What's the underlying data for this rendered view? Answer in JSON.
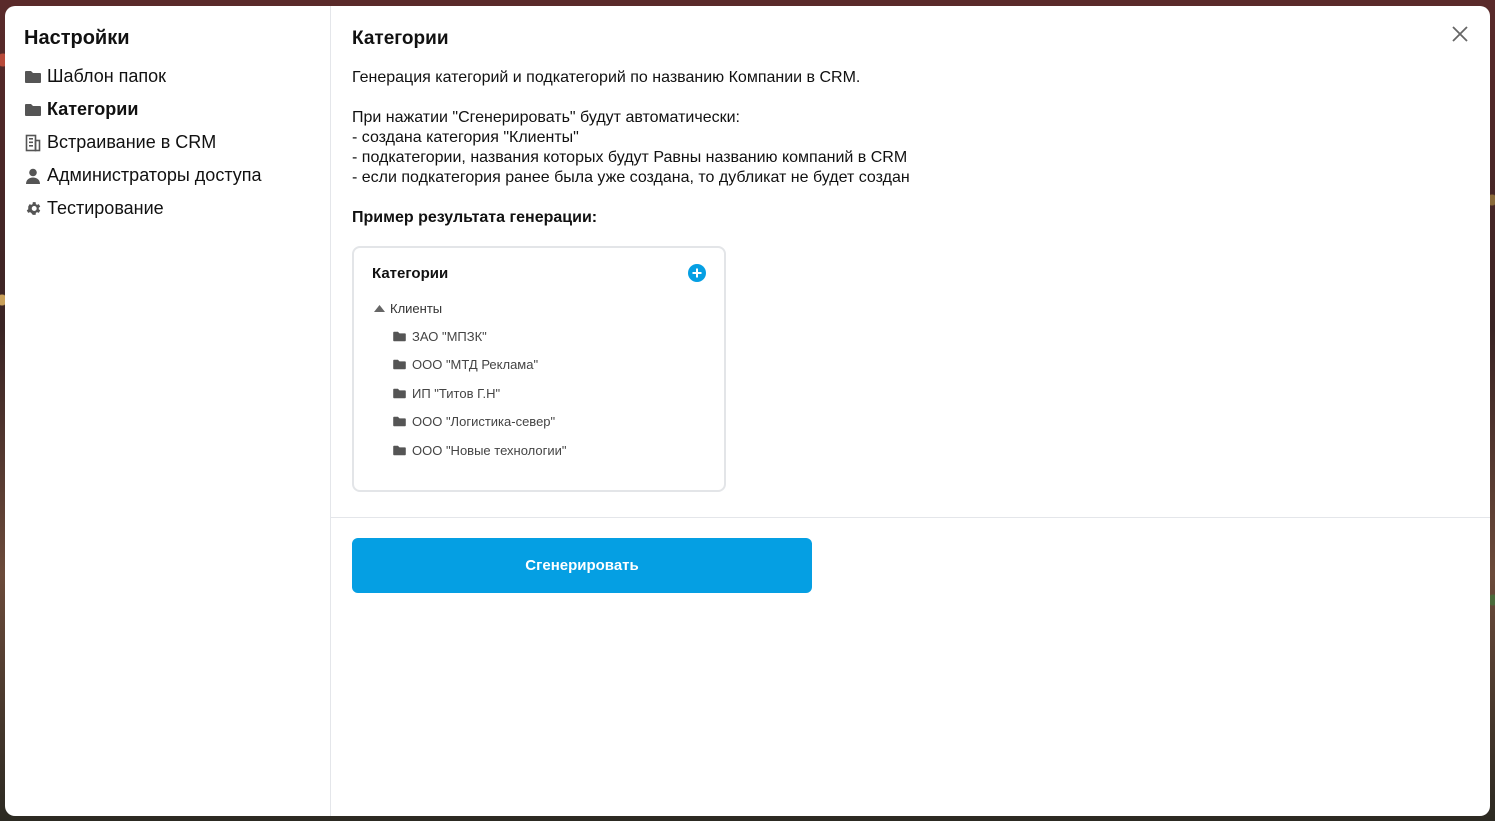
{
  "sidebar": {
    "title": "Настройки",
    "items": [
      {
        "label": "Шаблон папок",
        "icon": "folder-icon",
        "active": false
      },
      {
        "label": "Категории",
        "icon": "folder-icon",
        "active": true
      },
      {
        "label": "Встраивание в CRM",
        "icon": "building-icon",
        "active": false
      },
      {
        "label": "Администраторы доступа",
        "icon": "user-icon",
        "active": false
      },
      {
        "label": "Тестирование",
        "icon": "gear-icon",
        "active": false
      }
    ]
  },
  "main": {
    "title": "Категории",
    "description": "Генерация категорий и подкатегорий по названию Компании в CRM.",
    "intro": "При нажатии \"Сгенерировать\" будут автоматически:",
    "bullets": [
      "- создана категория \"Клиенты\"",
      "- подкатегории, названия которых будут Равны названию компаний в CRM",
      "- если подкатегория ранее была уже создана, то дубликат не будет создан"
    ],
    "example_title": "Пример результата генерации:",
    "example": {
      "card_title": "Категории",
      "root_label": "Клиенты",
      "children": [
        "ЗАО \"МПЗК\"",
        "ООО \"МТД Реклама\"",
        "ИП \"Титов Г.Н\"",
        "ООО \"Логистика-север\"",
        "ООО \"Новые технологии\""
      ]
    },
    "generate_button": "Сгенерировать"
  },
  "colors": {
    "accent": "#059fe3",
    "divider": "#e4e6ea",
    "icon_gray": "#555555"
  }
}
